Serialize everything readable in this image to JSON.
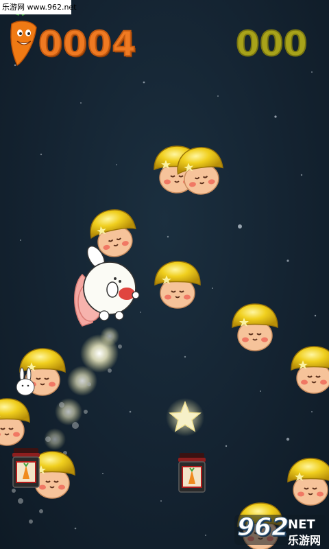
{
  "watermark": {
    "text": "乐游网 www.962.net"
  },
  "hud": {
    "score": "0004",
    "best_score_visible": "000",
    "carrot_icon": "carrot-mascot-icon"
  },
  "logo": {
    "number": "962",
    "suffix": "NET",
    "chinese": "乐游网"
  },
  "colors": {
    "background": "#142331",
    "score": "#ef7a22",
    "best_score": "#a8a31a",
    "mushroom_cap": "#e8c21a",
    "mushroom_face": "#f3b98c"
  },
  "sprites": {
    "mushrooms": 11,
    "jars": 2,
    "stars": 1,
    "player": "bunny-with-pink-cape"
  }
}
